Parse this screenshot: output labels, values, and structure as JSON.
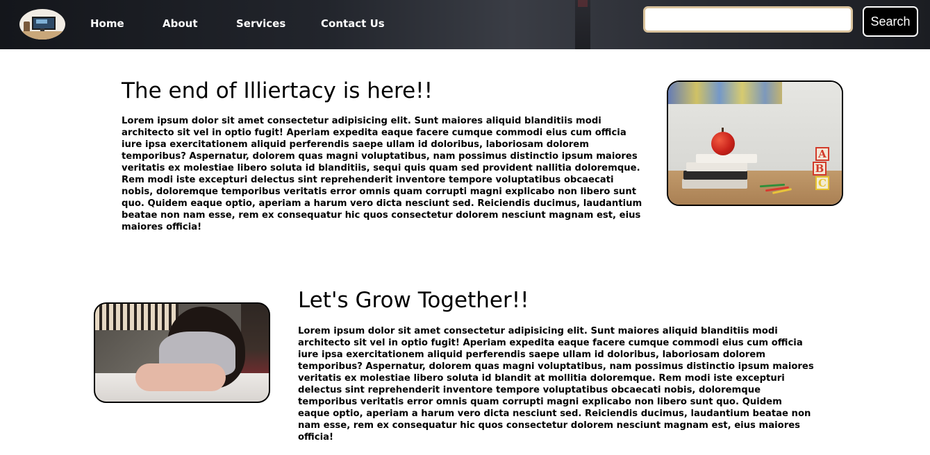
{
  "nav": {
    "logo_alt": "desk-logo",
    "links": [
      "Home",
      "About",
      "Services",
      "Contact Us"
    ],
    "search": {
      "placeholder": "",
      "value": "",
      "button_label": "Search"
    },
    "search_border_color": "#d9c29c"
  },
  "sections": [
    {
      "heading": "The end of Illiertacy is here!!",
      "paragraph": "Lorem ipsum dolor sit amet consectetur adipisicing elit. Sunt maiores aliquid blanditiis modi architecto sit vel in optio fugit! Aperiam expedita eaque facere cumque commodi eius cum officia iure ipsa exercitationem aliquid perferendis saepe ullam id doloribus, laboriosam dolorem temporibus? Aspernatur, dolorem quas magni voluptatibus, nam possimus distinctio ipsum maiores veritatis ex molestiae libero soluta id blanditiis, sequi quis quam sed provident nallitia doloremque. Rem modi iste excepturi delectus sint reprehenderit inventore tempore voluptatibus obcaecati nobis, doloremque temporibus veritatis error omnis quam corrupti magni explicabo non libero sunt quo. Quidem eaque optio, aperiam a harum vero dicta nesciunt sed. Reiciendis ducimus, laudantium beatae non nam esse, rem ex consequatur hic quos consectetur dolorem nesciunt magnam est, eius maiores officia!",
      "image": "desk-apple-books-photo"
    },
    {
      "heading": "Let's Grow Together!!",
      "paragraph": "Lorem ipsum dolor sit amet consectetur adipisicing elit. Sunt maiores aliquid blanditiis modi architecto sit vel in optio fugit! Aperiam expedita eaque facere cumque commodi eius cum officia iure ipsa exercitationem aliquid perferendis saepe ullam id doloribus, laboriosam dolorem temporibus? Aspernatur, dolorem quas magni voluptatibus, nam possimus distinctio ipsum maiores veritatis ex molestiae libero soluta id blandit at mollitia doloremque. Rem modi iste excepturi delectus sint reprehenderit inventore tempore voluptatibus obcaecati nobis, doloremque temporibus veritatis error omnis quam corrupti magni explicabo non libero sunt quo. Quidem eaque optio, aperiam a harum vero dicta nesciunt sed. Reiciendis ducimus, laudantium beatae non nam esse, rem ex consequatur hic quos consectetur dolorem nesciunt magnam est, eius maiores officia!",
      "image": "girl-reading-photo"
    }
  ],
  "image1_blocks": [
    "A",
    "B",
    "C"
  ]
}
